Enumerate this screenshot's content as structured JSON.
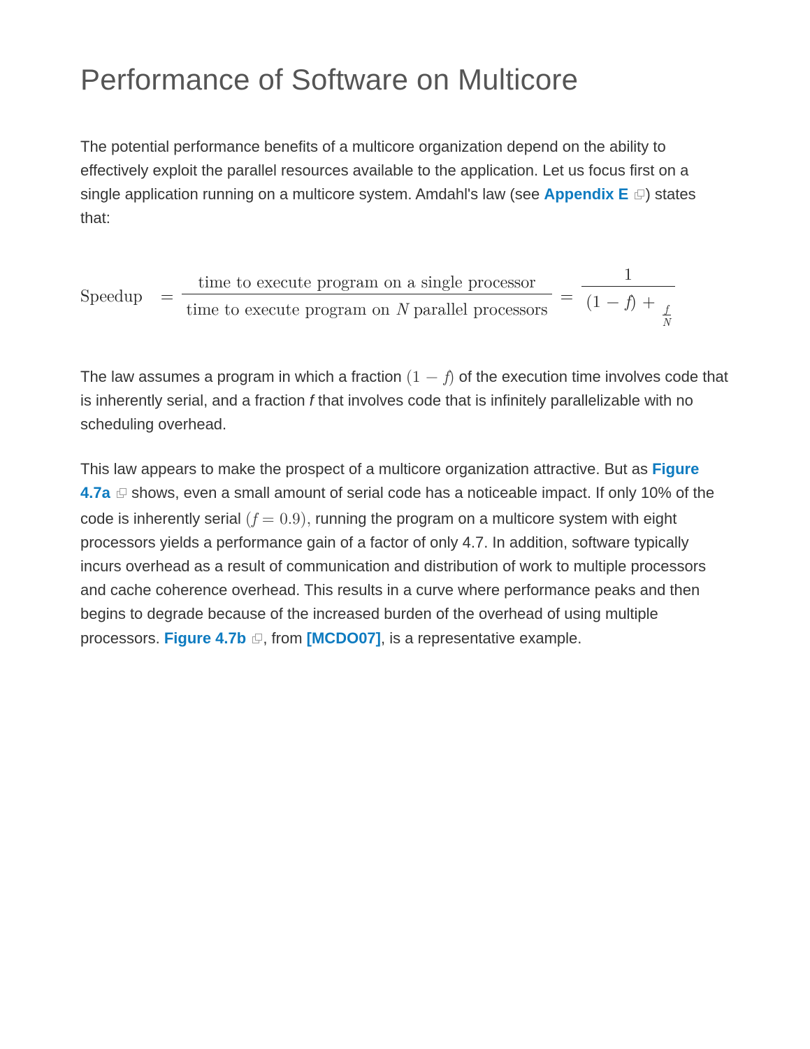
{
  "title": "Performance of Software on Multicore",
  "p1": {
    "seg1": "The potential performance benefits of a multicore organization depend on the ability to effectively exploit the parallel resources available to the application. Let us focus first on a single application running on a multicore system. Amdahl's law (see ",
    "link1": "Appendix E",
    "seg2": ") states that:"
  },
  "formula": {
    "lhs": "Speedup",
    "frac1_num": "time to execute program on a single processor",
    "frac1_den_a": "time to execute program on ",
    "frac1_den_N": "N",
    "frac1_den_b": " parallel processors",
    "rhs_num": "1",
    "rhs_den_a": "(1 − ",
    "rhs_den_f": "f",
    "rhs_den_b": ") + ",
    "small_num": "f",
    "small_den": "N"
  },
  "p2": {
    "seg1": "The law assumes a program in which a fraction ",
    "math1_a": "(1 − ",
    "math1_f": "f",
    "math1_b": ")",
    "seg2": " of the execution time involves code that is inherently serial, and a fraction ",
    "math_f_alone": "f",
    "seg3": " that involves code that is infinitely parallelizable with no scheduling overhead."
  },
  "p3": {
    "seg1": "This law appears to make the prospect of a multicore organization attractive. But as ",
    "link1": "Figure 4.7a",
    "seg2": " shows, even a small amount of serial code has a noticeable impact. If only 10% of the code is inherently serial ",
    "math2_a": "(",
    "math2_f": "f",
    "math2_b": " = 0.9),",
    "seg3": " running the program on a multicore system with eight processors yields a performance gain of a factor of only 4.7. In addition, software typically incurs overhead as a result of communication and distribution of work to multiple processors and cache coherence overhead. This results in a curve where performance peaks and then begins to degrade because of the increased burden of the overhead of using multiple processors. ",
    "link2": "Figure 4.7b",
    "seg4": ", from ",
    "link3": "[MCDO07]",
    "seg5": ", is a representative example."
  }
}
